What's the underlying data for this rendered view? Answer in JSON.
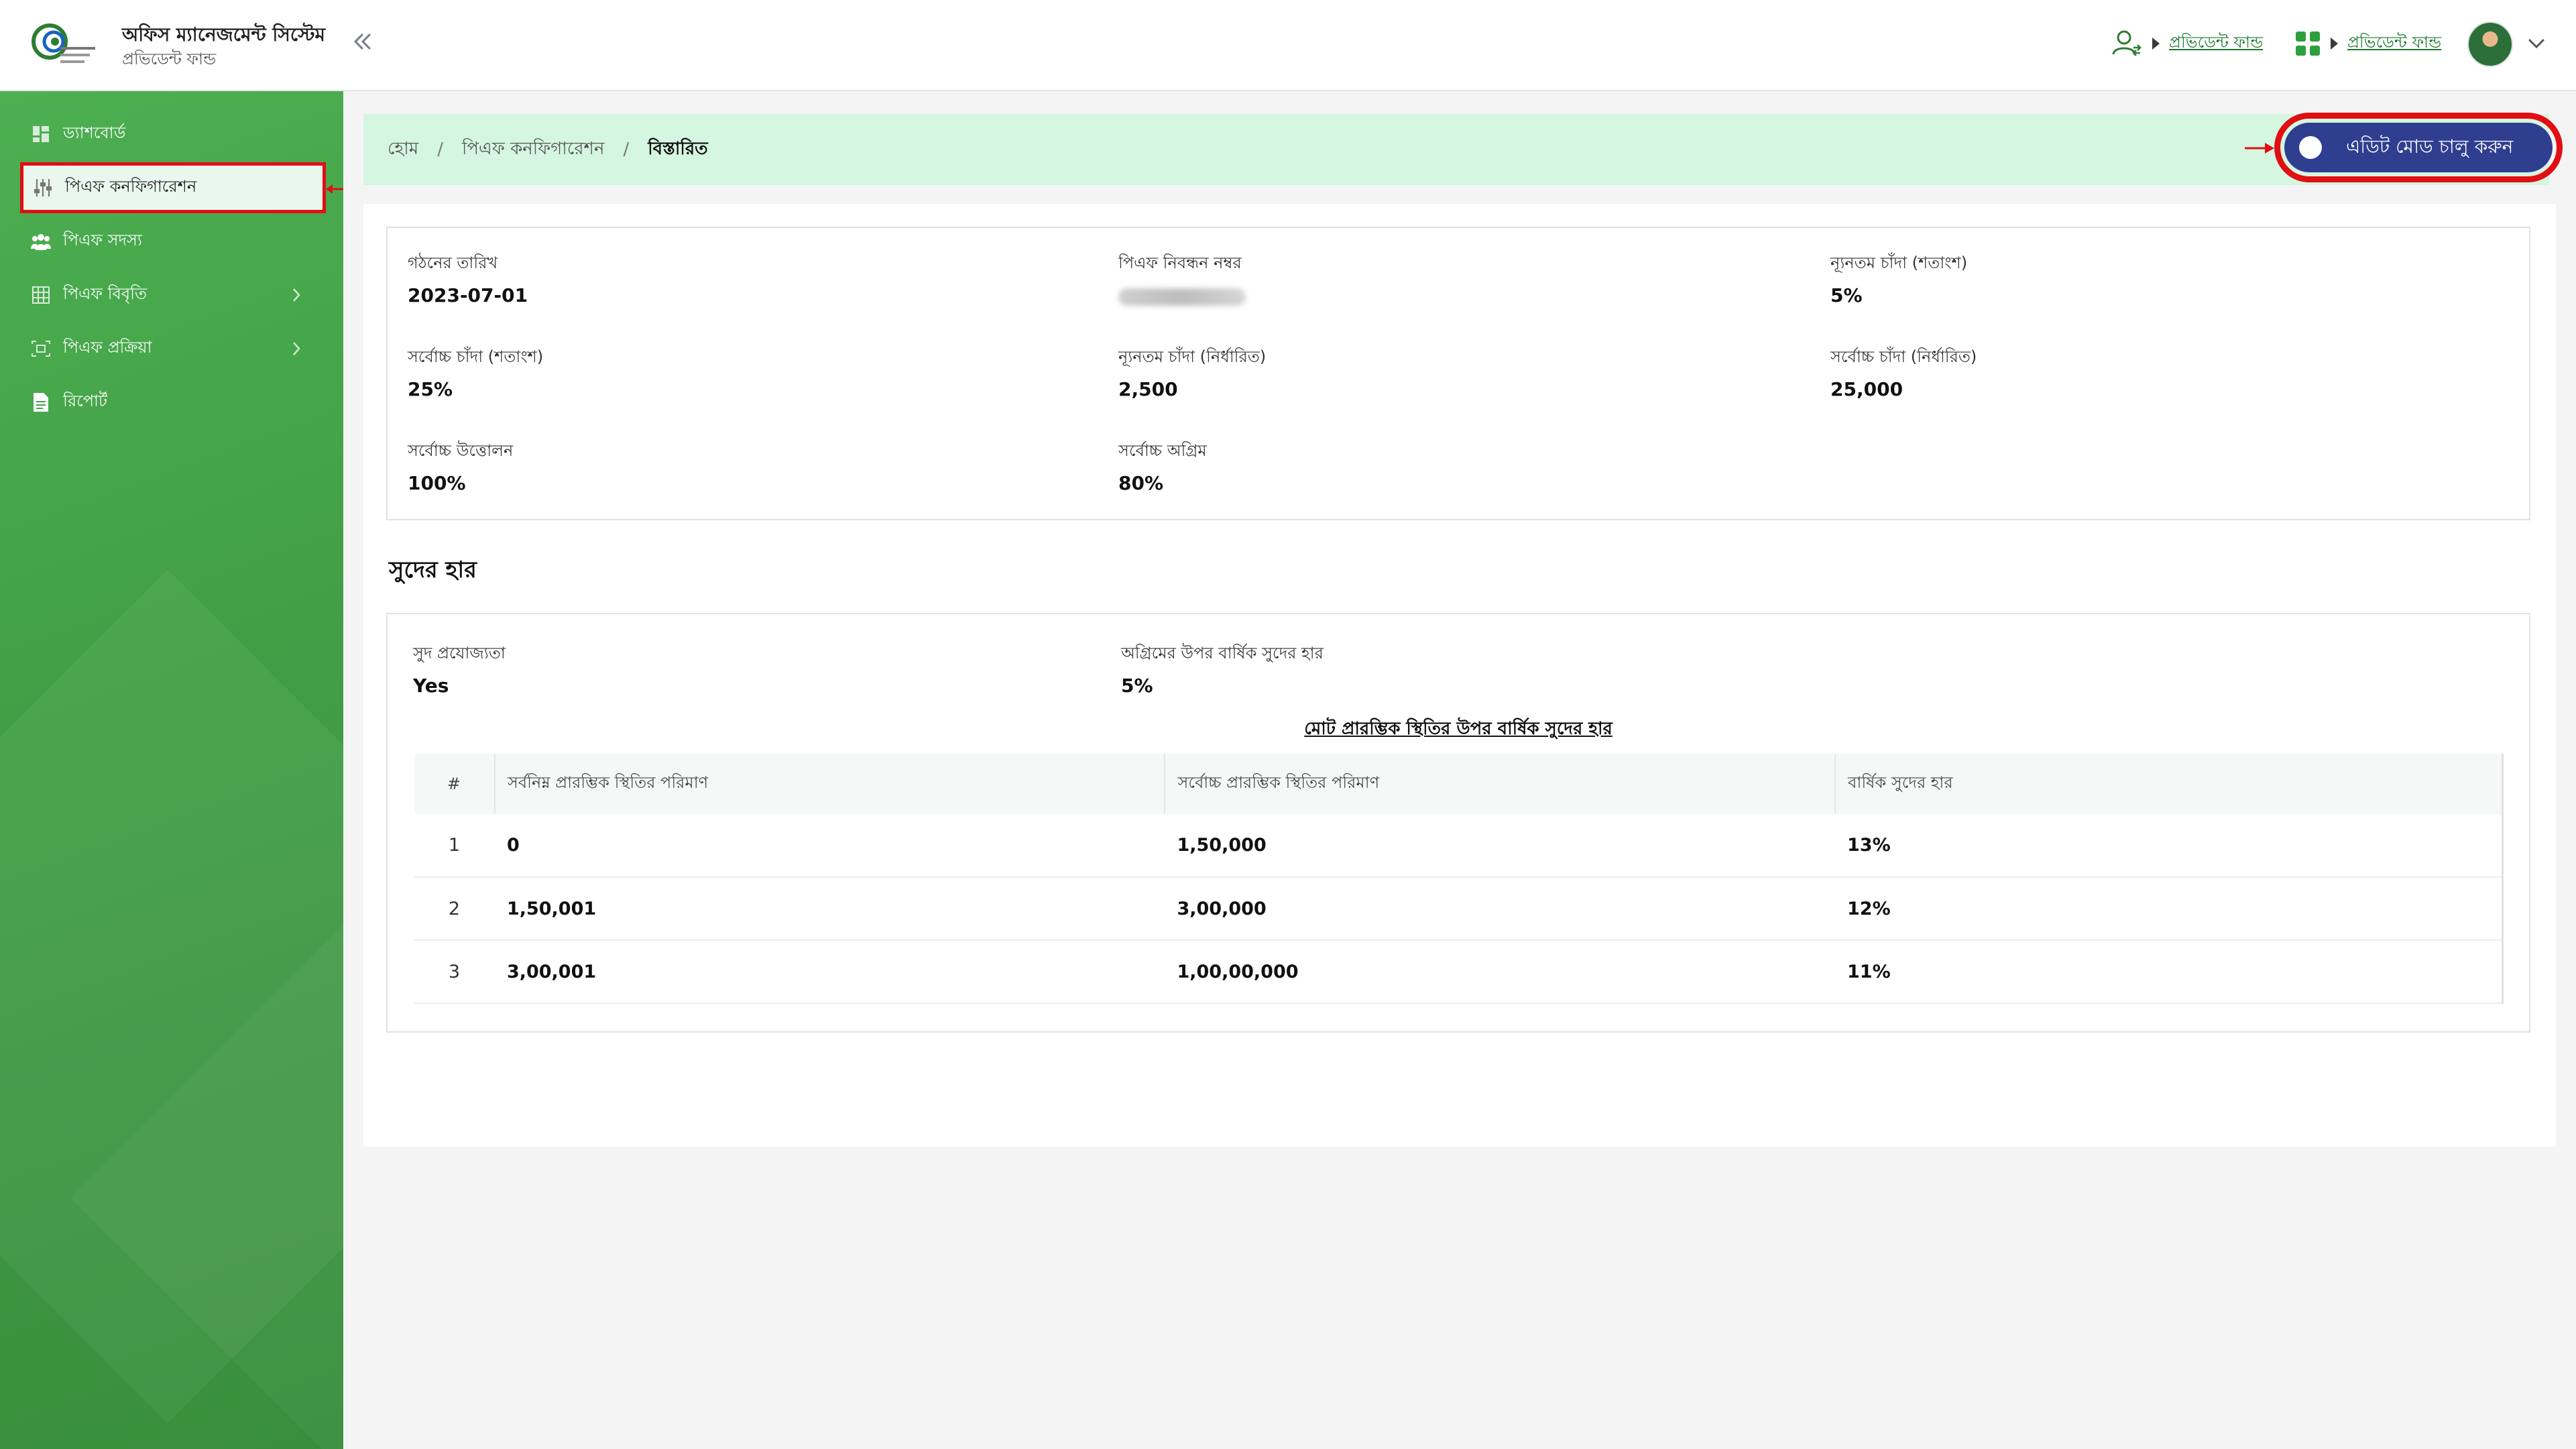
{
  "header": {
    "app_title": "অফিস ম্যানেজমেন্ট সিস্টেম",
    "app_subtitle": "প্রভিডেন্ট ফান্ড",
    "links": [
      {
        "label": "প্রভিডেন্ট ফান্ড",
        "icon": "user-switch-icon"
      },
      {
        "label": "প্রভিডেন্ট ফান্ড",
        "icon": "apps-grid-icon"
      }
    ]
  },
  "sidebar": {
    "items": [
      {
        "label": "ড্যাশবোর্ড",
        "icon": "dashboard-icon"
      },
      {
        "label": "পিএফ কনফিগারেশন",
        "icon": "sliders-icon",
        "active": true
      },
      {
        "label": "পিএফ সদস্য",
        "icon": "members-icon"
      },
      {
        "label": "পিএফ বিবৃতি",
        "icon": "statement-icon"
      },
      {
        "label": "পিএফ প্রক্রিয়া",
        "icon": "process-icon"
      },
      {
        "label": "রিপোর্ট",
        "icon": "report-icon"
      }
    ]
  },
  "breadcrumb": {
    "home": "হোম",
    "config": "পিএফ কনফিগারেশন",
    "current": "বিস্তারিত"
  },
  "edit_mode": {
    "label": "এডিট মোড চালু করুন",
    "enabled": false
  },
  "config": {
    "formation_date_label": "গঠনের তারিখ",
    "formation_date": "2023-07-01",
    "registration_no_label": "পিএফ নিবন্ধন নম্বর",
    "min_contribution_pct_label": "ন্যূনতম চাঁদা (শতাংশ)",
    "min_contribution_pct": "5%",
    "max_contribution_pct_label": "সর্বোচ্চ চাঁদা (শতাংশ)",
    "max_contribution_pct": "25%",
    "min_contribution_fixed_label": "ন্যূনতম চাঁদা (নির্ধারিত)",
    "min_contribution_fixed": "2,500",
    "max_contribution_fixed_label": "সর্বোচ্চ চাঁদা (নির্ধারিত)",
    "max_contribution_fixed": "25,000",
    "max_withdrawal_label": "সর্বোচ্চ উত্তোলন",
    "max_withdrawal": "100%",
    "max_advance_label": "সর্বোচ্চ অগ্রিম",
    "max_advance": "80%"
  },
  "interest": {
    "section_title": "সুদের হার",
    "applicable_label": "সুদ প্রযোজ্যতা",
    "applicable": "Yes",
    "advance_rate_label": "অগ্রিমের উপর বার্ষিক সুদের হার",
    "advance_rate": "5%",
    "table_title": "মোট প্রারম্ভিক স্থিতির উপর বার্ষিক সুদের হার",
    "columns": [
      "#",
      "সর্বনিম্ন প্রারম্ভিক স্থিতির পরিমাণ",
      "সর্বোচ্চ প্রারম্ভিক স্থিতির পরিমাণ",
      "বার্ষিক সুদের হার"
    ],
    "rows": [
      [
        "1",
        "0",
        "1,50,000",
        "13%"
      ],
      [
        "2",
        "1,50,001",
        "3,00,000",
        "12%"
      ],
      [
        "3",
        "3,00,001",
        "1,00,00,000",
        "11%"
      ]
    ]
  },
  "colors": {
    "sidebar_green": "#43a047",
    "breadcrumb_bg": "#d5f6e1",
    "edit_button": "#2f3e8f",
    "highlight_red": "#e10e14",
    "link_green": "#1b7a2f"
  }
}
